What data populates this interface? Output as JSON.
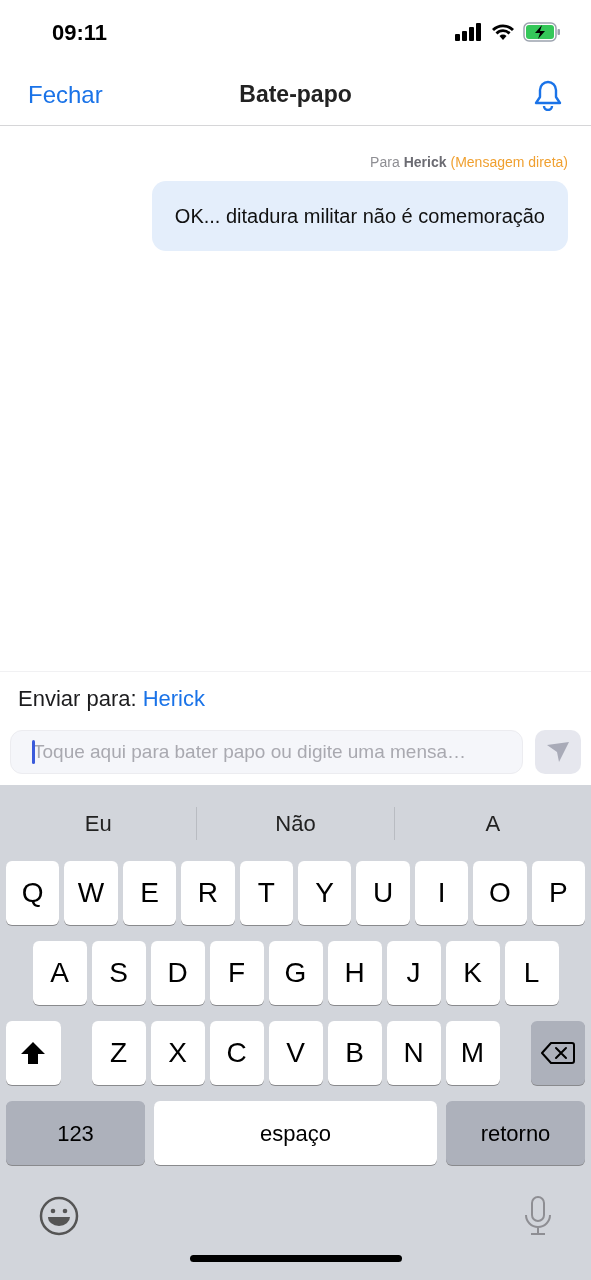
{
  "status_bar": {
    "time": "09:11"
  },
  "nav": {
    "close": "Fechar",
    "title": "Bate-papo"
  },
  "messages": [
    {
      "to_label": "Para",
      "to_name": "Herick",
      "note": "(Mensagem direta)",
      "text": "OK... ditadura militar não é comemoração"
    }
  ],
  "compose": {
    "send_to_label": "Enviar para:",
    "recipient": "Herick",
    "placeholder": "Toque aqui para bater papo ou digite uma mensa…"
  },
  "keyboard": {
    "suggestions": [
      "Eu",
      "Não",
      "A"
    ],
    "rows": [
      [
        {
          "kind": "letter",
          "label": "Q"
        },
        {
          "kind": "letter",
          "label": "W"
        },
        {
          "kind": "letter",
          "label": "E"
        },
        {
          "kind": "letter",
          "label": "R"
        },
        {
          "kind": "letter",
          "label": "T"
        },
        {
          "kind": "letter",
          "label": "Y"
        },
        {
          "kind": "letter",
          "label": "U"
        },
        {
          "kind": "letter",
          "label": "I"
        },
        {
          "kind": "letter",
          "label": "O"
        },
        {
          "kind": "letter",
          "label": "P"
        }
      ],
      [
        {
          "kind": "letter",
          "label": "A"
        },
        {
          "kind": "letter",
          "label": "S"
        },
        {
          "kind": "letter",
          "label": "D"
        },
        {
          "kind": "letter",
          "label": "F"
        },
        {
          "kind": "letter",
          "label": "G"
        },
        {
          "kind": "letter",
          "label": "H"
        },
        {
          "kind": "letter",
          "label": "J"
        },
        {
          "kind": "letter",
          "label": "K"
        },
        {
          "kind": "letter",
          "label": "L"
        }
      ],
      [
        {
          "kind": "shift"
        },
        {
          "kind": "letter",
          "label": "Z"
        },
        {
          "kind": "letter",
          "label": "X"
        },
        {
          "kind": "letter",
          "label": "C"
        },
        {
          "kind": "letter",
          "label": "V"
        },
        {
          "kind": "letter",
          "label": "B"
        },
        {
          "kind": "letter",
          "label": "N"
        },
        {
          "kind": "letter",
          "label": "M"
        },
        {
          "kind": "backspace"
        }
      ]
    ],
    "bottom_row": [
      {
        "kind": "mode",
        "label": "123"
      },
      {
        "kind": "space",
        "label": "espaço"
      },
      {
        "kind": "return",
        "label": "retorno"
      }
    ]
  }
}
